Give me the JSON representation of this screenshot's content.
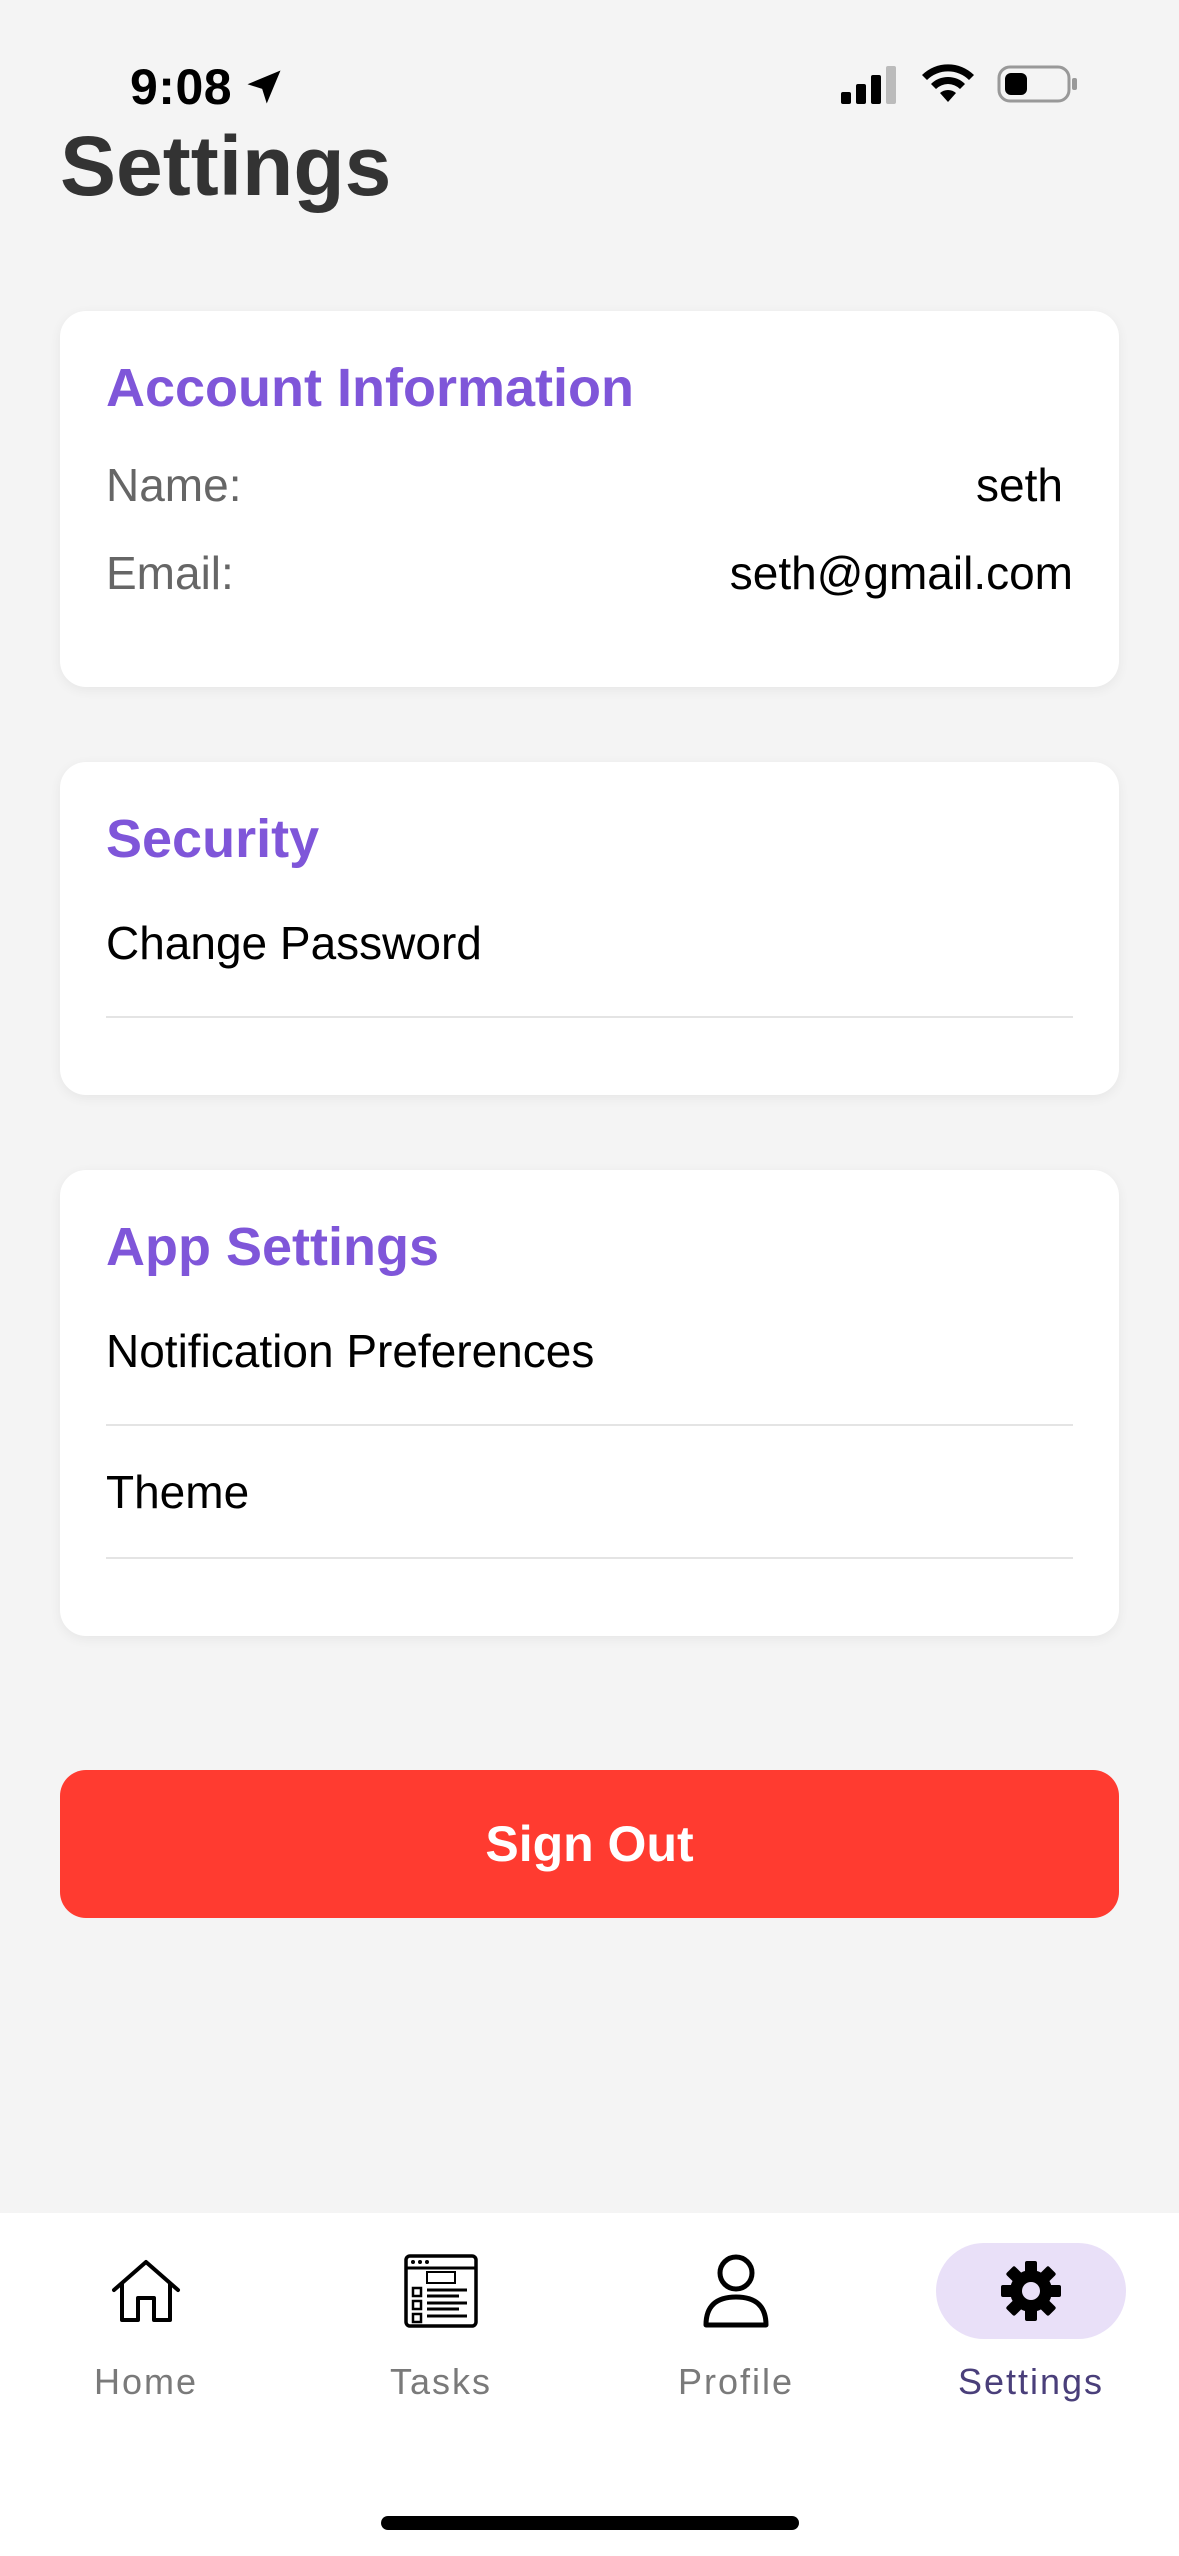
{
  "status": {
    "time": "9:08"
  },
  "page": {
    "title": "Settings"
  },
  "account": {
    "title": "Account Information",
    "name_label": "Name:",
    "name_value": "seth",
    "email_label": "Email:",
    "email_value": "seth@gmail.com"
  },
  "security": {
    "title": "Security",
    "items": [
      "Change Password"
    ]
  },
  "app_settings": {
    "title": "App Settings",
    "items": [
      "Notification Preferences",
      "Theme"
    ]
  },
  "sign_out": {
    "label": "Sign Out"
  },
  "tabs": [
    {
      "label": "Home",
      "icon": "home-icon",
      "active": false
    },
    {
      "label": "Tasks",
      "icon": "tasks-icon",
      "active": false
    },
    {
      "label": "Profile",
      "icon": "profile-icon",
      "active": false
    },
    {
      "label": "Settings",
      "icon": "gear-icon",
      "active": true
    }
  ],
  "colors": {
    "accent": "#7f56d9",
    "danger": "#ff3b30",
    "active_tab_bg": "#e9e0f8",
    "background": "#f4f4f4"
  }
}
